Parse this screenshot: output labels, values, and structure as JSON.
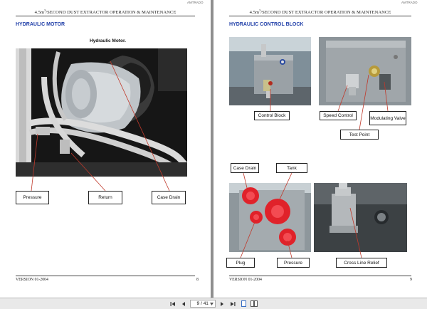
{
  "left_page": {
    "header_title": "4.5m",
    "header_sup": "3",
    "header_rest": "/SECOND DUST EXTRACTOR OPERATION & MAINTENANCE",
    "logo": "AMTRADO",
    "section_title": "HYDRAULIC MOTOR",
    "photo_caption": "Hydraulic Motor.",
    "labels": {
      "pressure": "Pressure",
      "return": "Return",
      "case_drain": "Case Drain"
    },
    "footer_version": "VERSION 01-2004",
    "page_number": "8"
  },
  "right_page": {
    "header_title": "4.5m",
    "header_sup": "3",
    "header_rest": "/SECOND DUST EXTRACTOR OPERATION & MAINTENANCE",
    "logo": "AMTRADO",
    "section_title": "HYDRAULIC CONTROL BLOCK",
    "labels": {
      "control_block": "Control Block",
      "speed_control": "Speed Control",
      "modulating_valve": "Modulating Valve",
      "test_point": "Test Point",
      "case_drain": "Case Drain",
      "tank": "Tank",
      "plug": "Plug",
      "pressure": "Pressure",
      "cross_line_relief": "Cross Line Relief"
    },
    "footer_version": "VERSION 01-2004",
    "page_number": "9"
  },
  "toolbar": {
    "first_icon": "first-page-icon",
    "prev_icon": "prev-page-icon",
    "current_page": "9",
    "total_pages": "/ 41",
    "next_icon": "next-page-icon",
    "last_icon": "last-page-icon",
    "single_page_icon": "single-page-view-icon",
    "double_page_icon": "double-page-view-icon"
  }
}
